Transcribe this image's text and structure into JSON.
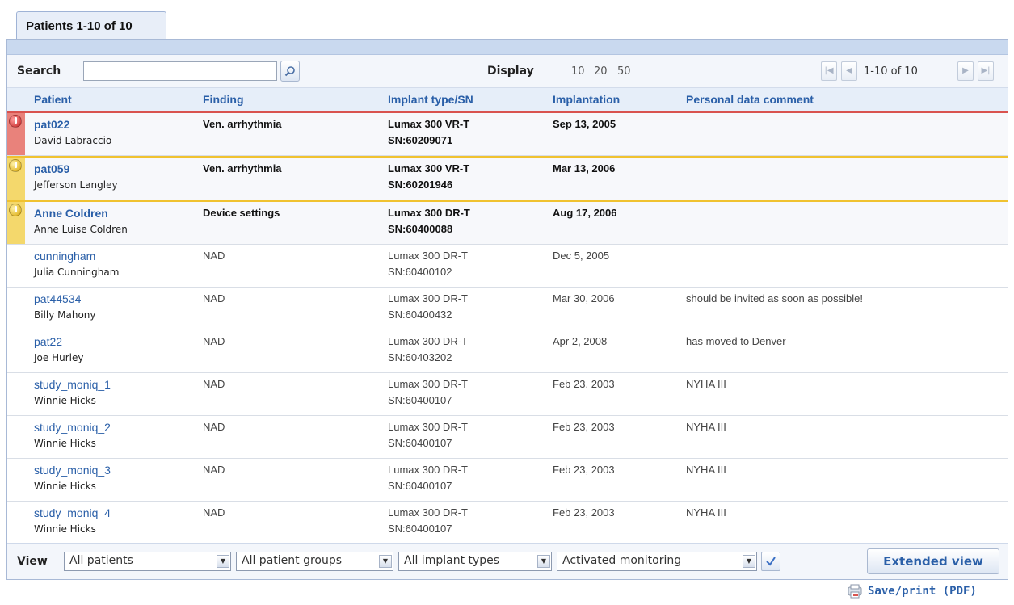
{
  "tab": {
    "label": "Patients 1-10 of 10"
  },
  "toolbar": {
    "search_label": "Search",
    "search_value": "",
    "display_label": "Display",
    "display_options": [
      "10",
      "20",
      "50"
    ],
    "pager_range": "1-10 of 10"
  },
  "columns": [
    "Patient",
    "Finding",
    "Implant type/SN",
    "Implantation",
    "Personal data comment"
  ],
  "rows": [
    {
      "id": "pat022",
      "name": "David Labraccio",
      "finding": "Ven. arrhythmia",
      "implant": "Lumax 300 VR-T",
      "sn": "SN:60209071",
      "date": "Sep 13, 2005",
      "comment": "",
      "alert": "red"
    },
    {
      "id": "pat059",
      "name": "Jefferson Langley",
      "finding": "Ven. arrhythmia",
      "implant": "Lumax 300 VR-T",
      "sn": "SN:60201946",
      "date": "Mar 13, 2006",
      "comment": "",
      "alert": "yellow"
    },
    {
      "id": "Anne Coldren",
      "name": "Anne Luise Coldren",
      "finding": "Device settings",
      "implant": "Lumax 300 DR-T",
      "sn": "SN:60400088",
      "date": "Aug 17, 2006",
      "comment": "",
      "alert": "yellow"
    },
    {
      "id": "cunningham",
      "name": "Julia Cunningham",
      "finding": "NAD",
      "implant": "Lumax 300 DR-T",
      "sn": "SN:60400102",
      "date": "Dec 5, 2005",
      "comment": "",
      "alert": ""
    },
    {
      "id": "pat44534",
      "name": "Billy Mahony",
      "finding": "NAD",
      "implant": "Lumax 300 DR-T",
      "sn": "SN:60400432",
      "date": "Mar 30, 2006",
      "comment": "should be invited as soon as possible!",
      "alert": ""
    },
    {
      "id": "pat22",
      "name": "Joe Hurley",
      "finding": "NAD",
      "implant": "Lumax 300 DR-T",
      "sn": "SN:60403202",
      "date": "Apr 2, 2008",
      "comment": "has moved to Denver",
      "alert": ""
    },
    {
      "id": "study_moniq_1",
      "name": "Winnie Hicks",
      "finding": "NAD",
      "implant": "Lumax 300 DR-T",
      "sn": "SN:60400107",
      "date": "Feb 23, 2003",
      "comment": "NYHA III",
      "alert": ""
    },
    {
      "id": "study_moniq_2",
      "name": "Winnie Hicks",
      "finding": "NAD",
      "implant": "Lumax 300 DR-T",
      "sn": "SN:60400107",
      "date": "Feb 23, 2003",
      "comment": "NYHA III",
      "alert": ""
    },
    {
      "id": "study_moniq_3",
      "name": "Winnie Hicks",
      "finding": "NAD",
      "implant": "Lumax 300 DR-T",
      "sn": "SN:60400107",
      "date": "Feb 23, 2003",
      "comment": "NYHA III",
      "alert": ""
    },
    {
      "id": "study_moniq_4",
      "name": "Winnie Hicks",
      "finding": "NAD",
      "implant": "Lumax 300 DR-T",
      "sn": "SN:60400107",
      "date": "Feb 23, 2003",
      "comment": "NYHA III",
      "alert": ""
    }
  ],
  "footer": {
    "view_label": "View",
    "filters": [
      "All patients",
      "All patient groups",
      "All implant types",
      "Activated monitoring"
    ],
    "extended_view_label": "Extended view"
  },
  "pdf_label": "Save/print (PDF)",
  "colors": {
    "link": "#2a5fa8",
    "alert_red": "#e9827b",
    "alert_yellow": "#f4d86c",
    "header_bg": "#e6eef9"
  }
}
